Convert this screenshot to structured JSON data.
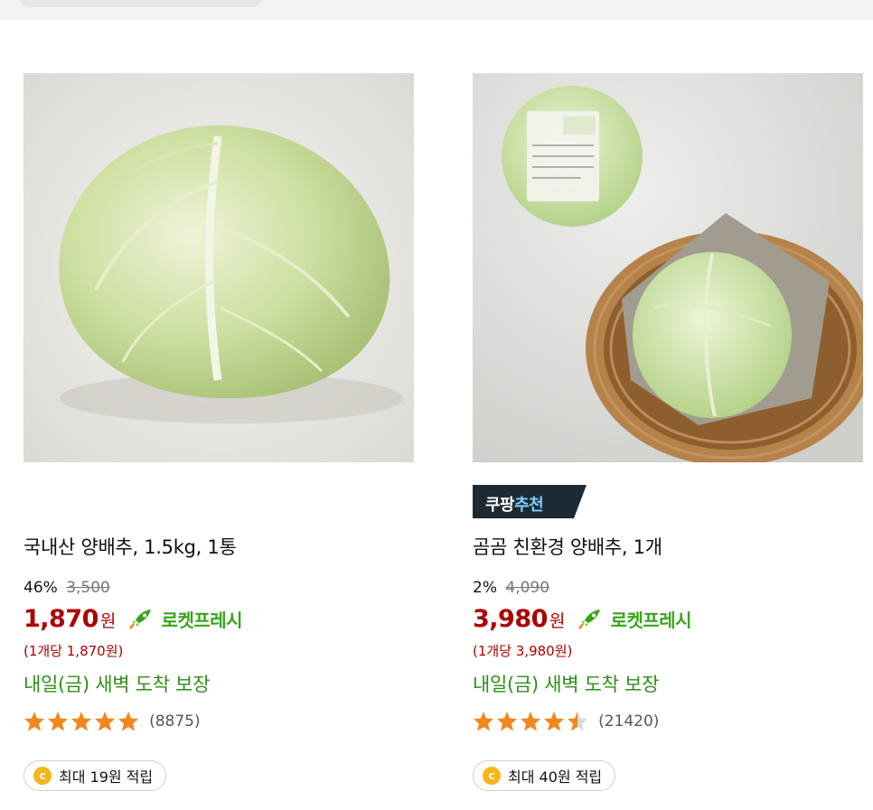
{
  "products": [
    {
      "title": "국내산 양배추, 1.5kg, 1통",
      "discount_pct": "46%",
      "original_price": "3,500",
      "price": "1,870",
      "price_unit": "원",
      "rocket_label": "로켓프레시",
      "unit_price": "(1개당 1,870원)",
      "delivery": "내일(금) 새벽 도착 보장",
      "rating": 5.0,
      "rating_count": "(8875)",
      "coin_glyph": "c",
      "reward": "최대 19원 적립",
      "image_icon": "cabbage-photo",
      "has_recommend_badge": false
    },
    {
      "recommend_badge_prefix": "쿠팡",
      "recommend_badge_suffix": "추천",
      "title": "곰곰 친환경 양배추, 1개",
      "discount_pct": "2%",
      "original_price": "4,090",
      "price": "3,980",
      "price_unit": "원",
      "rocket_label": "로켓프레시",
      "unit_price": "(1개당 3,980원)",
      "delivery": "내일(금) 새벽 도착 보장",
      "rating": 4.5,
      "rating_count": "(21420)",
      "coin_glyph": "c",
      "reward": "최대 40원 적립",
      "image_icon": "cabbage-basket-photo",
      "has_recommend_badge": true
    }
  ],
  "colors": {
    "price_red": "#ae0000",
    "delivery_green": "#2f8f18",
    "rocket_green": "#37a51a",
    "star_orange": "#f2871c",
    "badge_dark": "#1e2a33",
    "coin_gold": "#f5b51b"
  }
}
